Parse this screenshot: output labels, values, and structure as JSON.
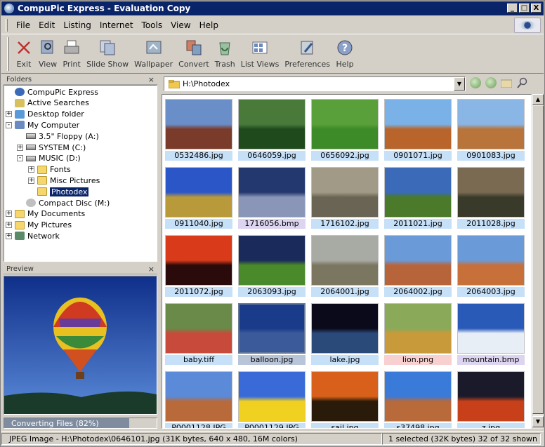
{
  "window": {
    "title": "CompuPic Express - Evaluation Copy",
    "min": "_",
    "max": "□",
    "close": "X"
  },
  "menu": [
    "File",
    "Edit",
    "Listing",
    "Internet",
    "Tools",
    "View",
    "Help"
  ],
  "toolbar": [
    "Exit",
    "View",
    "Print",
    "Slide Show",
    "Wallpaper",
    "Convert",
    "Trash",
    "List Views",
    "Preferences",
    "Help"
  ],
  "folders": {
    "title": "Folders",
    "close": "×",
    "items": [
      {
        "label": "CompuPic Express",
        "type": "globe",
        "exp": ""
      },
      {
        "label": "Active Searches",
        "type": "search",
        "exp": ""
      },
      {
        "label": "Desktop folder",
        "type": "desktop",
        "exp": "+"
      },
      {
        "label": "My Computer",
        "type": "computer",
        "exp": "-"
      },
      {
        "label": "3.5\" Floppy (A:)",
        "type": "drive",
        "exp": ""
      },
      {
        "label": "SYSTEM (C:)",
        "type": "drive",
        "exp": "+"
      },
      {
        "label": "MUSIC (D:)",
        "type": "drive",
        "exp": "-"
      },
      {
        "label": "Fonts",
        "type": "folder",
        "exp": "+"
      },
      {
        "label": "Misc Pictures",
        "type": "folder",
        "exp": "+"
      },
      {
        "label": "Photodex",
        "type": "folder",
        "exp": "",
        "selected": true
      },
      {
        "label": "Compact Disc (M:)",
        "type": "cd",
        "exp": ""
      },
      {
        "label": "My Documents",
        "type": "folder",
        "exp": "+"
      },
      {
        "label": "My Pictures",
        "type": "folder",
        "exp": "+"
      },
      {
        "label": "Network",
        "type": "network",
        "exp": "+"
      }
    ]
  },
  "preview": {
    "title": "Preview",
    "close": "×"
  },
  "progress": {
    "label": "Converting Files (82%)",
    "percent": 82
  },
  "address": {
    "path": "H:\\Photodex"
  },
  "thumbnails": [
    {
      "name": "0532486.jpg",
      "sky": "#6a8fc8",
      "ground": "#7a3b2a",
      "tag": "blue"
    },
    {
      "name": "0646059.jpg",
      "sky": "#4a7a3a",
      "ground": "#1f4a1c",
      "tag": "blue"
    },
    {
      "name": "0656092.jpg",
      "sky": "#5aa03a",
      "ground": "#3c8a28",
      "tag": "blue"
    },
    {
      "name": "0901071.jpg",
      "sky": "#7ab2e8",
      "ground": "#b8642a",
      "tag": "blue"
    },
    {
      "name": "0901083.jpg",
      "sky": "#8ab6e6",
      "ground": "#b8743a",
      "tag": "blue"
    },
    {
      "name": "0911040.jpg",
      "sky": "#2a56c8",
      "ground": "#b89a3a",
      "tag": "blue"
    },
    {
      "name": "1716056.bmp",
      "sky": "#243870",
      "ground": "#8a96b8",
      "tag": "lav"
    },
    {
      "name": "1716102.jpg",
      "sky": "#a09a86",
      "ground": "#6a6454",
      "tag": "blue"
    },
    {
      "name": "2011021.jpg",
      "sky": "#3a6ab8",
      "ground": "#4a7a2a",
      "tag": "blue"
    },
    {
      "name": "2011028.jpg",
      "sky": "#7a6a52",
      "ground": "#3a3a2a",
      "tag": "blue"
    },
    {
      "name": "2011072.jpg",
      "sky": "#d83a1a",
      "ground": "#2a0a0a",
      "tag": "blue"
    },
    {
      "name": "2063093.jpg",
      "sky": "#1a2a5a",
      "ground": "#4a8a2a",
      "tag": "blue"
    },
    {
      "name": "2064001.jpg",
      "sky": "#a8aaa4",
      "ground": "#7a7660",
      "tag": "blue"
    },
    {
      "name": "2064002.jpg",
      "sky": "#6a9ad8",
      "ground": "#b8643a",
      "tag": "blue"
    },
    {
      "name": "2064003.jpg",
      "sky": "#6a9ad8",
      "ground": "#c8703a",
      "tag": "blue"
    },
    {
      "name": "baby.tiff",
      "sky": "#6a8a4a",
      "ground": "#c84a3a",
      "tag": "blue"
    },
    {
      "name": "balloon.jpg",
      "sky": "#1a3a8a",
      "ground": "#3a5a9a",
      "tag": "gray"
    },
    {
      "name": "lake.jpg",
      "sky": "#0a0a1a",
      "ground": "#2a4a7a",
      "tag": "blue"
    },
    {
      "name": "lion.png",
      "sky": "#8aaa5a",
      "ground": "#c89a3a",
      "tag": "pink"
    },
    {
      "name": "mountain.bmp",
      "sky": "#2a5ab8",
      "ground": "#e8eef6",
      "tag": "lav"
    },
    {
      "name": "P0001128.JPG",
      "sky": "#5a8ad8",
      "ground": "#b86a3a",
      "tag": "blue"
    },
    {
      "name": "P0001129.JPG",
      "sky": "#3a6ad8",
      "ground": "#f0d020",
      "tag": "blue"
    },
    {
      "name": "sail.jpg",
      "sky": "#d8601a",
      "ground": "#2a1a0a",
      "tag": "blue"
    },
    {
      "name": "s37498.jpg",
      "sky": "#3a7ad8",
      "ground": "#b86a3a",
      "tag": "blue"
    },
    {
      "name": "z.jpg",
      "sky": "#1a1a2a",
      "ground": "#c8401a",
      "tag": "blue"
    }
  ],
  "status": {
    "left": "JPEG Image - H:\\Photodex\\0646101.jpg  (31K bytes, 640 x 480, 16M colors)",
    "right": "1 selected (32K bytes) 32 of 32 shown"
  }
}
